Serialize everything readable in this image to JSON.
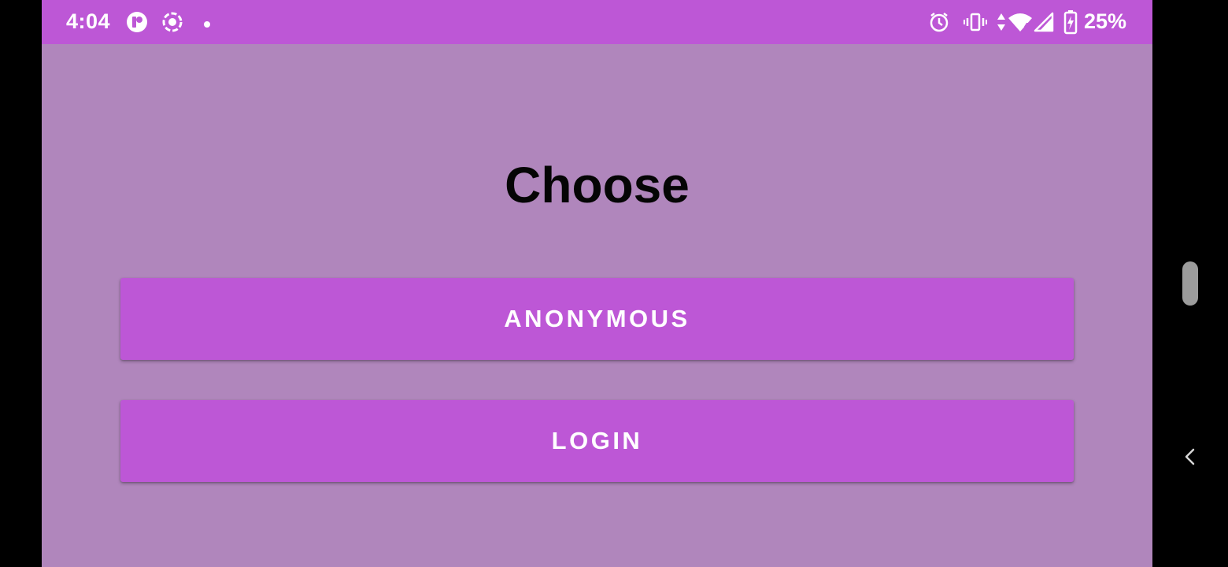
{
  "status_bar": {
    "time": "4:04",
    "left_icons": [
      "app-notification-icon",
      "screen-record-icon",
      "notification-dot-icon"
    ],
    "right_icons": [
      "alarm-icon",
      "vibrate-icon",
      "data-arrows-icon",
      "wifi-icon",
      "cell-signal-icon",
      "battery-charging-icon"
    ],
    "battery_percent": "25%"
  },
  "main": {
    "title": "Choose",
    "buttons": [
      {
        "label": "ANONYMOUS"
      },
      {
        "label": "LOGIN"
      }
    ]
  },
  "colors": {
    "accent": "#bd57d6",
    "background": "#b086bc",
    "title_text": "#050505",
    "button_text": "#ffffff"
  },
  "nav": {
    "side_icons": [
      "scroll-handle",
      "back-icon"
    ]
  }
}
